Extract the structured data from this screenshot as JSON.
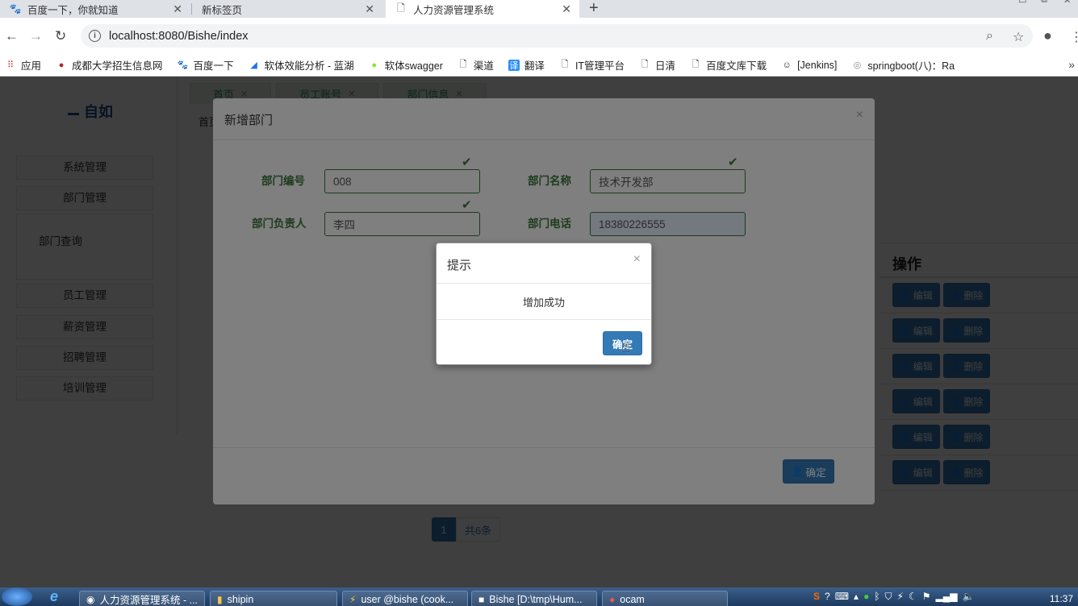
{
  "browser": {
    "tabs": [
      {
        "title": "百度一下，你就知道",
        "icon": "paw-icon",
        "active": false
      },
      {
        "title": "新标签页",
        "icon": "none",
        "active": false
      },
      {
        "title": "人力资源管理系统",
        "icon": "document-icon",
        "active": true
      }
    ],
    "url": "localhost:8080/Bishe/index",
    "bookmarks": [
      {
        "label": "应用",
        "icon": "apps-grid-icon"
      },
      {
        "label": "成都大学招生信息网",
        "icon": "university-icon"
      },
      {
        "label": "百度一下",
        "icon": "paw-icon"
      },
      {
        "label": "软体效能分析 - 蓝湖",
        "icon": "lanhu-icon"
      },
      {
        "label": "软体swagger",
        "icon": "swagger-icon"
      },
      {
        "label": "渠道",
        "icon": "document-icon"
      },
      {
        "label": "翻译",
        "icon": "translate-icon"
      },
      {
        "label": "IT管理平台",
        "icon": "document-icon"
      },
      {
        "label": "日清",
        "icon": "document-icon"
      },
      {
        "label": "百度文库下载",
        "icon": "document-icon"
      },
      {
        "label": "[Jenkins]",
        "icon": "jenkins-icon"
      },
      {
        "label": "springboot(八)：Ra",
        "icon": "springboot-icon"
      }
    ],
    "more_label": "»"
  },
  "sidebar": {
    "logo_text": "自如",
    "items": [
      {
        "label": "系统管理"
      },
      {
        "label": "部门管理"
      },
      {
        "label": "员工管理"
      },
      {
        "label": "薪资管理"
      },
      {
        "label": "招聘管理"
      },
      {
        "label": "培训管理"
      }
    ],
    "submenu": {
      "label": "部门查询"
    }
  },
  "page_tabs": [
    {
      "label": "首页"
    },
    {
      "label": "员工账号"
    },
    {
      "label": "部门信息"
    }
  ],
  "breadcrumb": "首页",
  "table": {
    "op_header": "操作",
    "edit_label": "编辑",
    "delete_label": "删除",
    "row_count": 6
  },
  "pager": {
    "current": "1",
    "total_label": "共6条"
  },
  "add_modal": {
    "title": "新增部门",
    "close": "×",
    "fields": {
      "dept_no": {
        "label": "部门编号",
        "value": "008"
      },
      "dept_name": {
        "label": "部门名称",
        "value": "技术开发部"
      },
      "dept_manager": {
        "label": "部门负责人",
        "value": "李四"
      },
      "dept_phone": {
        "label": "部门电话",
        "value": "18380226555"
      }
    },
    "confirm_label": "确定"
  },
  "alert": {
    "title": "提示",
    "close": "×",
    "message": "增加成功",
    "ok_label": "确定"
  },
  "taskbar": {
    "items": [
      {
        "label": "人力资源管理系统 - ..."
      },
      {
        "label": "shipin"
      },
      {
        "label": "user @bishe (cook..."
      },
      {
        "label": "Bishe [D:\\tmp\\Hum..."
      },
      {
        "label": "ocam"
      }
    ],
    "clock": "11:37"
  },
  "colors": {
    "primary": "#337ab7",
    "success": "#3c763d",
    "backdrop": "rgba(0,0,0,0.5)"
  }
}
